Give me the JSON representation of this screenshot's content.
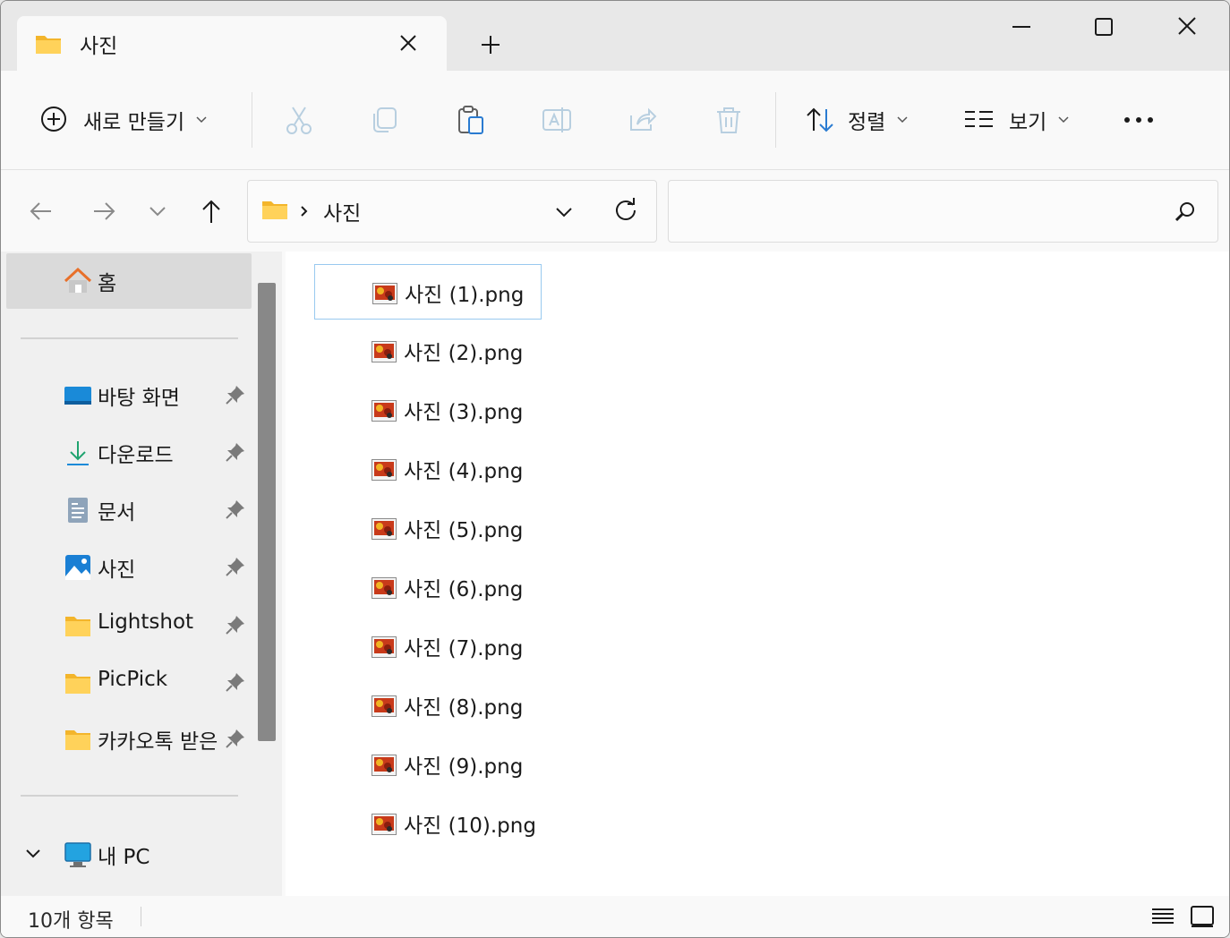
{
  "window": {
    "tab_title": "사진",
    "controls": [
      "minimize",
      "maximize",
      "close"
    ]
  },
  "toolbar": {
    "new_label": "새로 만들기",
    "sort_label": "정렬",
    "view_label": "보기",
    "icons": [
      "cut-icon",
      "copy-icon",
      "paste-icon",
      "rename-icon",
      "share-icon",
      "delete-icon",
      "more-icon"
    ]
  },
  "address": {
    "path": [
      "사진"
    ],
    "search_placeholder": ""
  },
  "sidebar": {
    "home_label": "홈",
    "quick_access": [
      {
        "label": "바탕 화면",
        "icon": "desktop-icon"
      },
      {
        "label": "다운로드",
        "icon": "download-icon"
      },
      {
        "label": "문서",
        "icon": "documents-icon"
      },
      {
        "label": "사진",
        "icon": "pictures-icon"
      },
      {
        "label": "Lightshot",
        "icon": "folder-icon"
      },
      {
        "label": "PicPick",
        "icon": "folder-icon"
      },
      {
        "label": "카카오톡 받은 파일",
        "icon": "folder-icon"
      }
    ],
    "this_pc_label": "내 PC"
  },
  "files": [
    "사진 (1).png",
    "사진 (2).png",
    "사진 (3).png",
    "사진 (4).png",
    "사진 (5).png",
    "사진 (6).png",
    "사진 (7).png",
    "사진 (8).png",
    "사진 (9).png",
    "사진 (10).png"
  ],
  "selected_file_index": 0,
  "status": {
    "item_count": "10개 항목"
  },
  "colors": {
    "selection_border": "#99c9ef",
    "folder_yellow": "#ffc83d",
    "accent_blue": "#0078d4"
  }
}
